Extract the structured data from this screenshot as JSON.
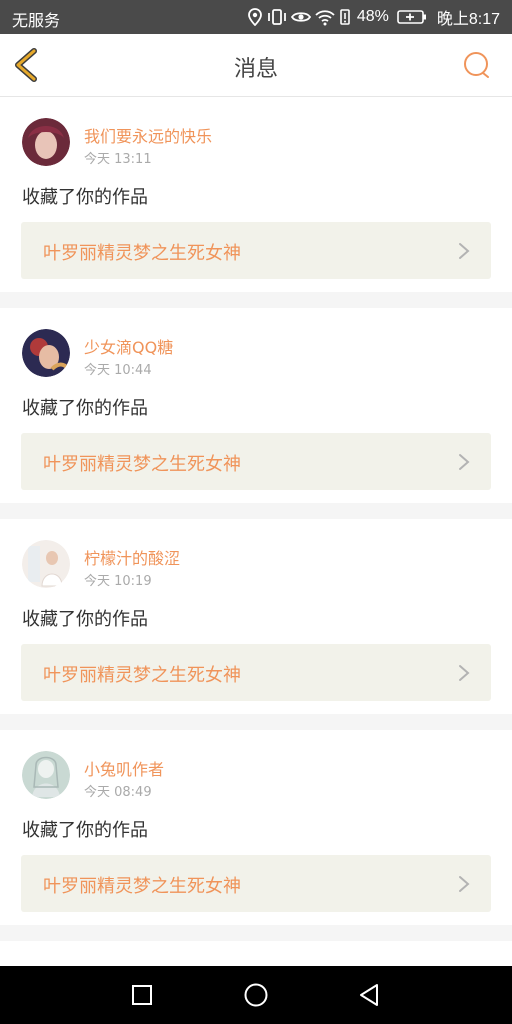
{
  "status_bar": {
    "carrier": "无服务",
    "battery": "48%",
    "time": "晚上8:17"
  },
  "header": {
    "title": "消息",
    "back_icon": "chevron-left-icon",
    "search_icon": "search-icon"
  },
  "colors": {
    "accent": "#f0945a",
    "back_icon": "#e6a92b",
    "card_bg": "#ffffff",
    "work_box_bg": "#f2f2ea"
  },
  "messages": [
    {
      "username": "我们要永远的快乐",
      "time": "今天 13:11",
      "action": "收藏了你的作品",
      "work_title": "叶罗丽精灵梦之生死女神"
    },
    {
      "username": "少女滴QQ糖",
      "time": "今天 10:44",
      "action": "收藏了你的作品",
      "work_title": "叶罗丽精灵梦之生死女神"
    },
    {
      "username": "柠檬汁的酸涩",
      "time": "今天 10:19",
      "action": "收藏了你的作品",
      "work_title": "叶罗丽精灵梦之生死女神"
    },
    {
      "username": "小兔叽作者",
      "time": "今天 08:49",
      "action": "收藏了你的作品",
      "work_title": "叶罗丽精灵梦之生死女神"
    }
  ],
  "nav_bar": {
    "recent_icon": "square-recent-apps-icon",
    "home_icon": "circle-home-icon",
    "back_icon": "triangle-back-icon"
  }
}
